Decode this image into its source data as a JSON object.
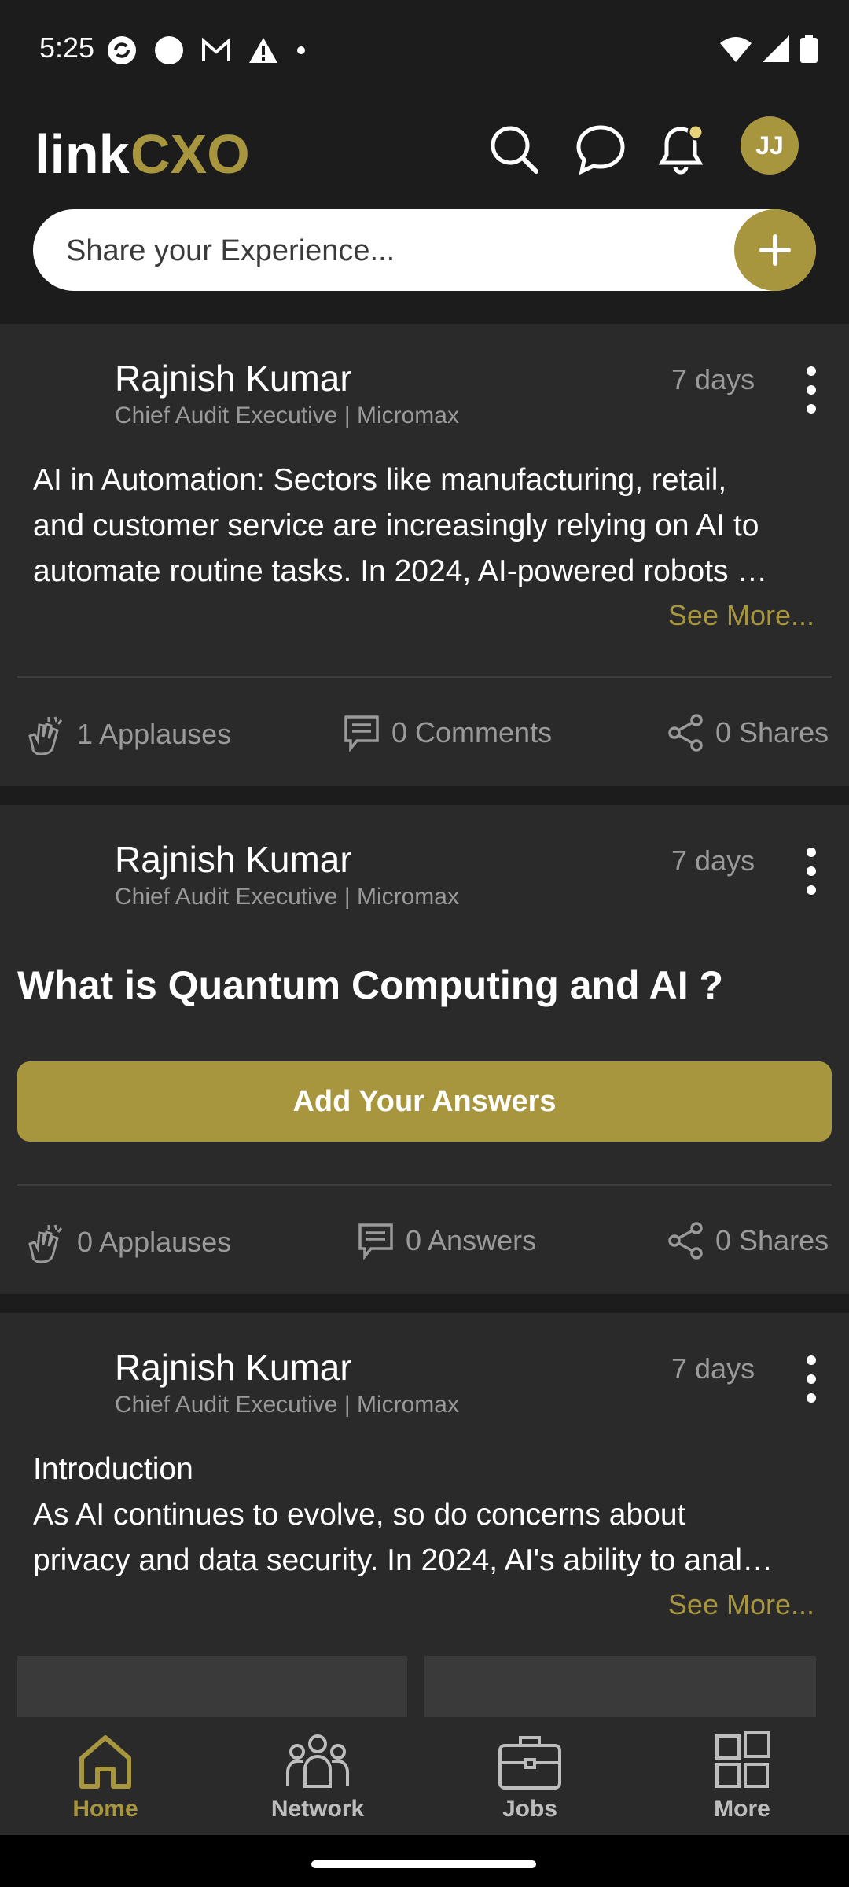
{
  "status_bar": {
    "time": "5:25"
  },
  "header": {
    "logo_text": "linkCXO",
    "avatar_initials": "JJ",
    "share_placeholder": "Share your Experience..."
  },
  "posts": [
    {
      "author": "Rajnish Kumar",
      "title": "Chief Audit Executive | Micromax",
      "time": "7 days",
      "text_lines": [
        "AI in Automation: Sectors like manufacturing, retail,",
        "and customer service are increasingly relying on AI to",
        "automate routine tasks. In 2024, AI-powered robots …"
      ],
      "see_more": "See More...",
      "applauses": "1 Applauses",
      "comments": "0 Comments",
      "shares": "0 Shares"
    },
    {
      "author": "Rajnish Kumar",
      "title": "Chief Audit Executive | Micromax",
      "time": "7 days",
      "question": "What is Quantum Computing and AI ?",
      "button": "Add Your Answers",
      "applauses": "0 Applauses",
      "answers": "0 Answers",
      "shares": "0 Shares"
    },
    {
      "author": "Rajnish Kumar",
      "title": "Chief Audit Executive | Micromax",
      "time": "7 days",
      "text_lines": [
        "Introduction",
        "As AI continues to evolve, so do concerns about",
        "privacy and data security. In 2024, AI's ability to anal…"
      ],
      "see_more": "See More..."
    }
  ],
  "bottom_nav": {
    "items": [
      {
        "label": "Home",
        "icon": "home-icon",
        "active": true
      },
      {
        "label": "Network",
        "icon": "network-icon",
        "active": false
      },
      {
        "label": "Jobs",
        "icon": "briefcase-icon",
        "active": false
      },
      {
        "label": "More",
        "icon": "grid-icon",
        "active": false
      }
    ]
  },
  "colors": {
    "accent": "#a8963e",
    "background": "#1c1c1c",
    "card": "#2a2a2a"
  }
}
